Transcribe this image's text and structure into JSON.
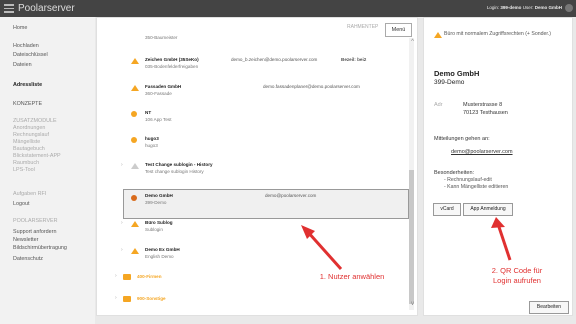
{
  "app": {
    "title": "Poolarserver"
  },
  "topbar": {
    "login_label": "Login:",
    "login_user": "399-demo",
    "user_label": "User:",
    "user_name": "Demo GmbH"
  },
  "sidebar": {
    "items": [
      {
        "label": "Home"
      },
      {
        "label": "Hochladen"
      },
      {
        "label": "Dateischlüssel"
      },
      {
        "label": "Dateien"
      },
      {
        "label": "Adressliste"
      },
      {
        "label": "KONZEPTE"
      },
      {
        "label": "ZUSATZMODULE"
      },
      {
        "label": "Anordnungen"
      },
      {
        "label": "Rechnungslauf"
      },
      {
        "label": "Mängelliste"
      },
      {
        "label": "Bautagebuch"
      },
      {
        "label": "Blickstatement-APP"
      },
      {
        "label": "Raumbuch"
      },
      {
        "label": "LPS-Tool"
      },
      {
        "label": "Aufgaben RFI"
      },
      {
        "label": "Logout"
      },
      {
        "label": "POOLARSERVER"
      },
      {
        "label": "Support anfordern"
      },
      {
        "label": "Newsletter"
      },
      {
        "label": "Bildschirmübertragung"
      },
      {
        "label": "Datenschutz"
      }
    ]
  },
  "main": {
    "rahmen_label": "RAHMENTEP",
    "menu_label": "Menü",
    "records": [
      {
        "title": "",
        "sub": "350-Baumeister",
        "email": "",
        "extra": ""
      },
      {
        "title": "Zeichen GmbH (35SeKo)",
        "sub": "035-Bodenfelderfreigaben",
        "email": "demo_b.zeichen@demo.poolarserver.com",
        "extra": "Bezeil: bei2"
      },
      {
        "title": "Fassaden GmbH",
        "sub": "360-Fassade",
        "email": "demo.fassadenplaner@demo.poolarserver.com",
        "extra": ""
      },
      {
        "title": "NT",
        "sub": "106 App Test",
        "email": "",
        "extra": ""
      },
      {
        "title": "hugo3",
        "sub": "hugo3",
        "email": "",
        "extra": ""
      },
      {
        "title": "Test Change sublogin - History",
        "sub": "Test change sublogin  History",
        "email": "",
        "extra": ""
      },
      {
        "title": "Demo GmbH",
        "sub": "399-Demo",
        "email": "demo@poolarserver.com",
        "extra": ""
      },
      {
        "title": "Büro Sublog",
        "sub": "Sublogin",
        "email": "",
        "extra": ""
      },
      {
        "title": "Demo Ex GmbH",
        "sub": "English Demo",
        "email": "",
        "extra": ""
      }
    ],
    "folders": [
      {
        "label": "400-Firmen"
      },
      {
        "label": "900-Sonstige"
      }
    ]
  },
  "details": {
    "warning": "Büro mit normalem Zugriffsrechten (+ Sonder.)",
    "company": "Demo GmbH",
    "code": "399-Demo",
    "adr_label": "Adr",
    "street": "Musterstrasse 8",
    "city": "70123 Testhausen",
    "mitteilungen_label": "Mitteilungen gehen an:",
    "email": "demo@poolarserver.com",
    "besonderheiten_label": "Besonderheiten:",
    "bes1": "- Rechnungslauf-edit",
    "bes2": "- Kann Mängelliste editieren",
    "vcard_label": "vCard",
    "app_label": "App Anmeldung",
    "edit_label": "Bearbeiten"
  },
  "annotations": {
    "step1": "1. Nutzer anwählen",
    "step2_line1": "2. QR Code für",
    "step2_line2": "Login aufrufen"
  },
  "colors": {
    "accent": "#f5a623",
    "annotation": "#e03030",
    "topbar": "#444444"
  }
}
